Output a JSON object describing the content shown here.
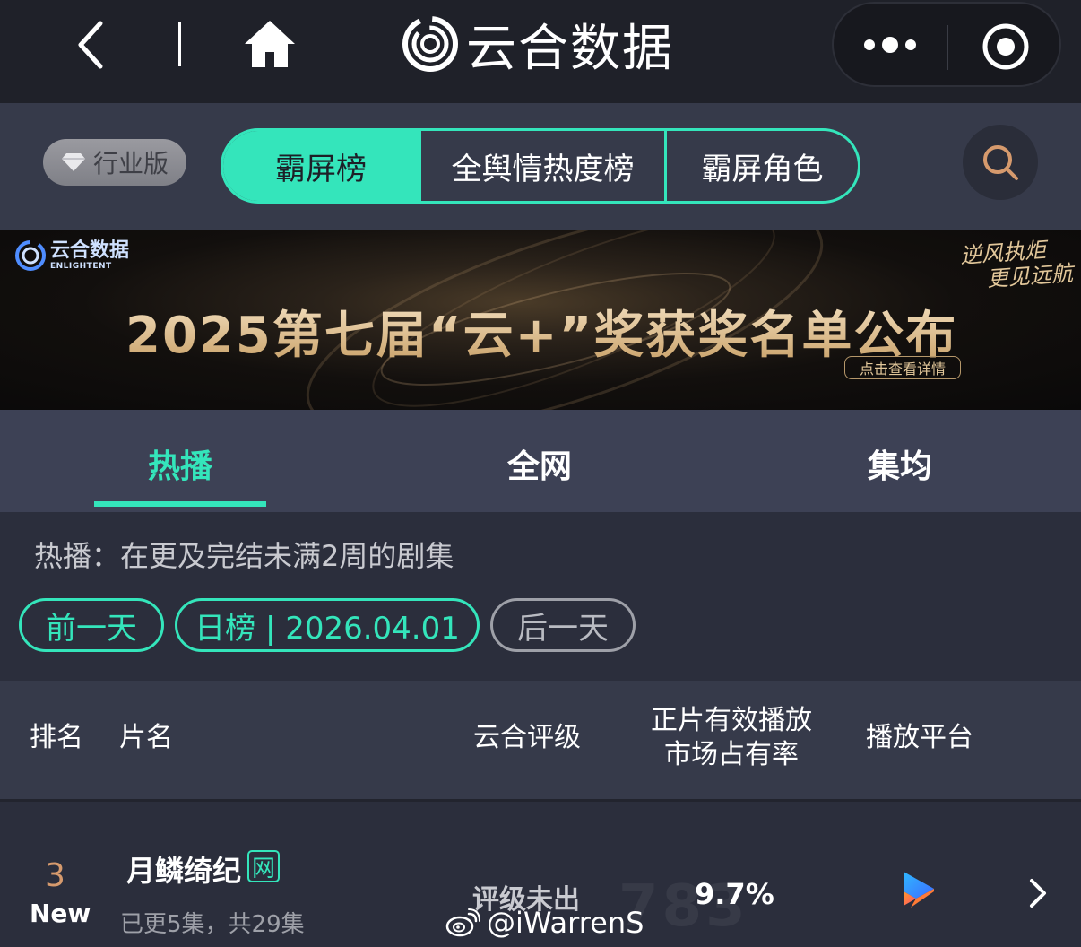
{
  "nav": {
    "brand_title": "云合数据"
  },
  "top_tabs": {
    "edition_label": "行业版",
    "segments": [
      {
        "label": "霸屏榜",
        "active": true
      },
      {
        "label": "全舆情热度榜",
        "active": false
      },
      {
        "label": "霸屏角色",
        "active": false
      }
    ]
  },
  "banner": {
    "logo_name": "云合数据",
    "logo_sub": "ENLIGHTENT",
    "headline": "2025第七届“云+”奖获奖名单公布",
    "slogan_line1": "逆风执炬",
    "slogan_line2": "更见远航",
    "cta": "点击查看详情"
  },
  "sub_tabs": [
    {
      "label": "热播",
      "active": true
    },
    {
      "label": "全网",
      "active": false
    },
    {
      "label": "集均",
      "active": false
    }
  ],
  "filter": {
    "description": "热播：在更及完结未满2周的剧集",
    "prev_label": "前一天",
    "date_label": "日榜 | 2026.04.01",
    "next_label": "后一天"
  },
  "table": {
    "headers": {
      "rank": "排名",
      "name": "片名",
      "rating": "云合评级",
      "share_line1": "正片有效播放",
      "share_line2": "市场占有率",
      "platform": "播放平台"
    },
    "rows": [
      {
        "rank": "3",
        "rank_tag": "New",
        "title": "月鳞绮纪",
        "badge": "网",
        "episodes": "已更5集，共29集",
        "rating": "评级未出",
        "share": "9.7%",
        "platform_icon": "youku-play-icon"
      }
    ]
  },
  "watermark": {
    "handle": "@iWarrenS",
    "faint": "783"
  },
  "colors": {
    "accent": "#34e5bb",
    "nav_bg": "#1f2129",
    "panel_bg": "#363a4a",
    "body_bg": "#2b2e3c",
    "rank_color": "#d69a6d"
  }
}
